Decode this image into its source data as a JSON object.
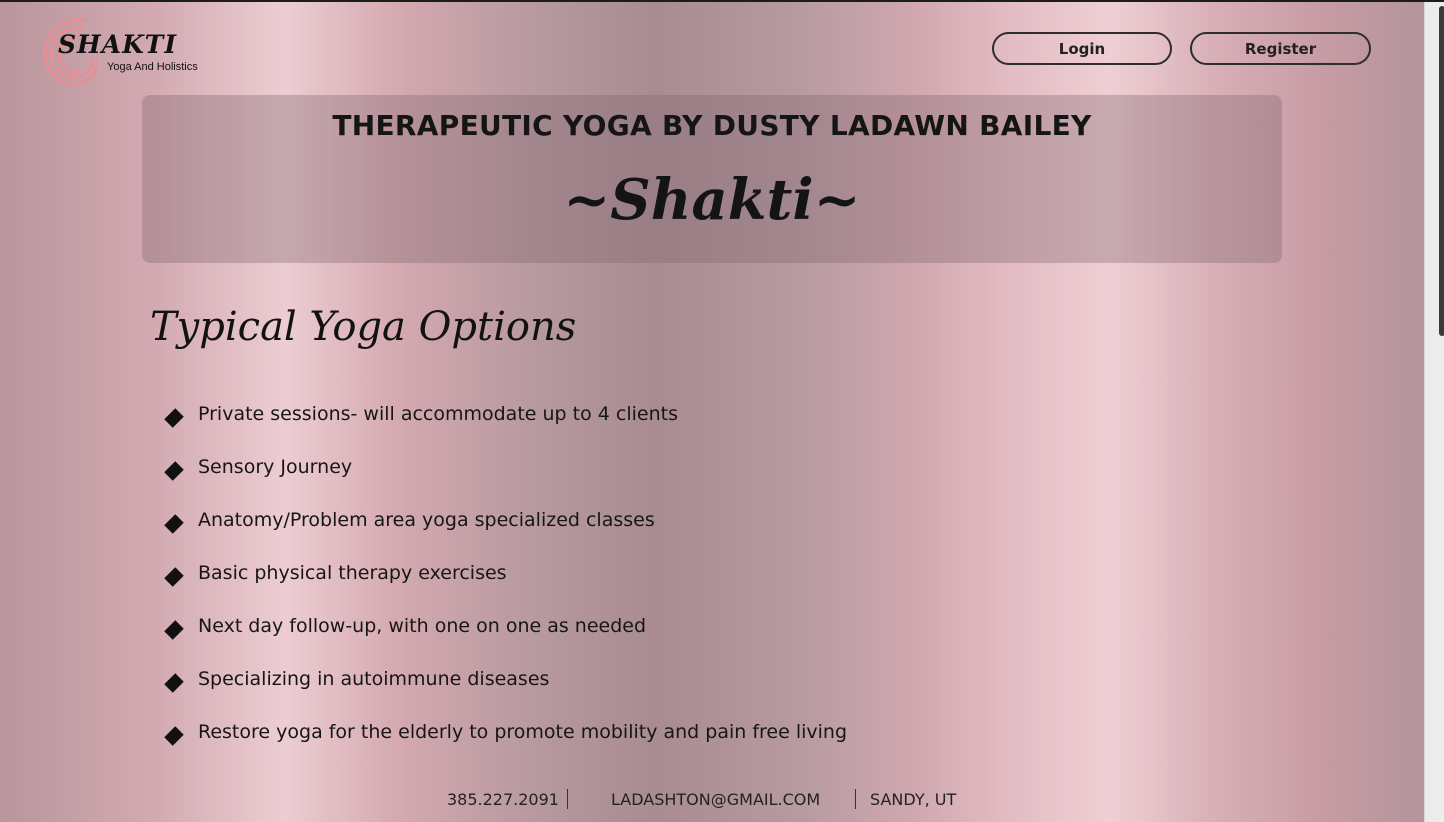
{
  "brand": {
    "name": "SHAKTI",
    "tagline": "Yoga And Holistics",
    "logo_color": "#e88f93"
  },
  "nav": {
    "login_label": "Login",
    "register_label": "Register"
  },
  "hero": {
    "title": "THERAPEUTIC YOGA BY DUSTY LADAWN BAILEY",
    "script": "~Shakti~"
  },
  "options": {
    "title": "Typical Yoga Options",
    "items": [
      "Private sessions- will accommodate up to 4 clients",
      "Sensory Journey",
      "Anatomy/Problem area yoga specialized classes",
      "Basic physical therapy exercises",
      "Next day follow-up, with one on one as needed",
      "Specializing in autoimmune diseases",
      "Restore yoga for the elderly to promote mobility and pain free living"
    ]
  },
  "footer": {
    "phone": "385.227.2091",
    "email": "LADASHTON@GMAIL.COM",
    "location": "SANDY, UT"
  }
}
